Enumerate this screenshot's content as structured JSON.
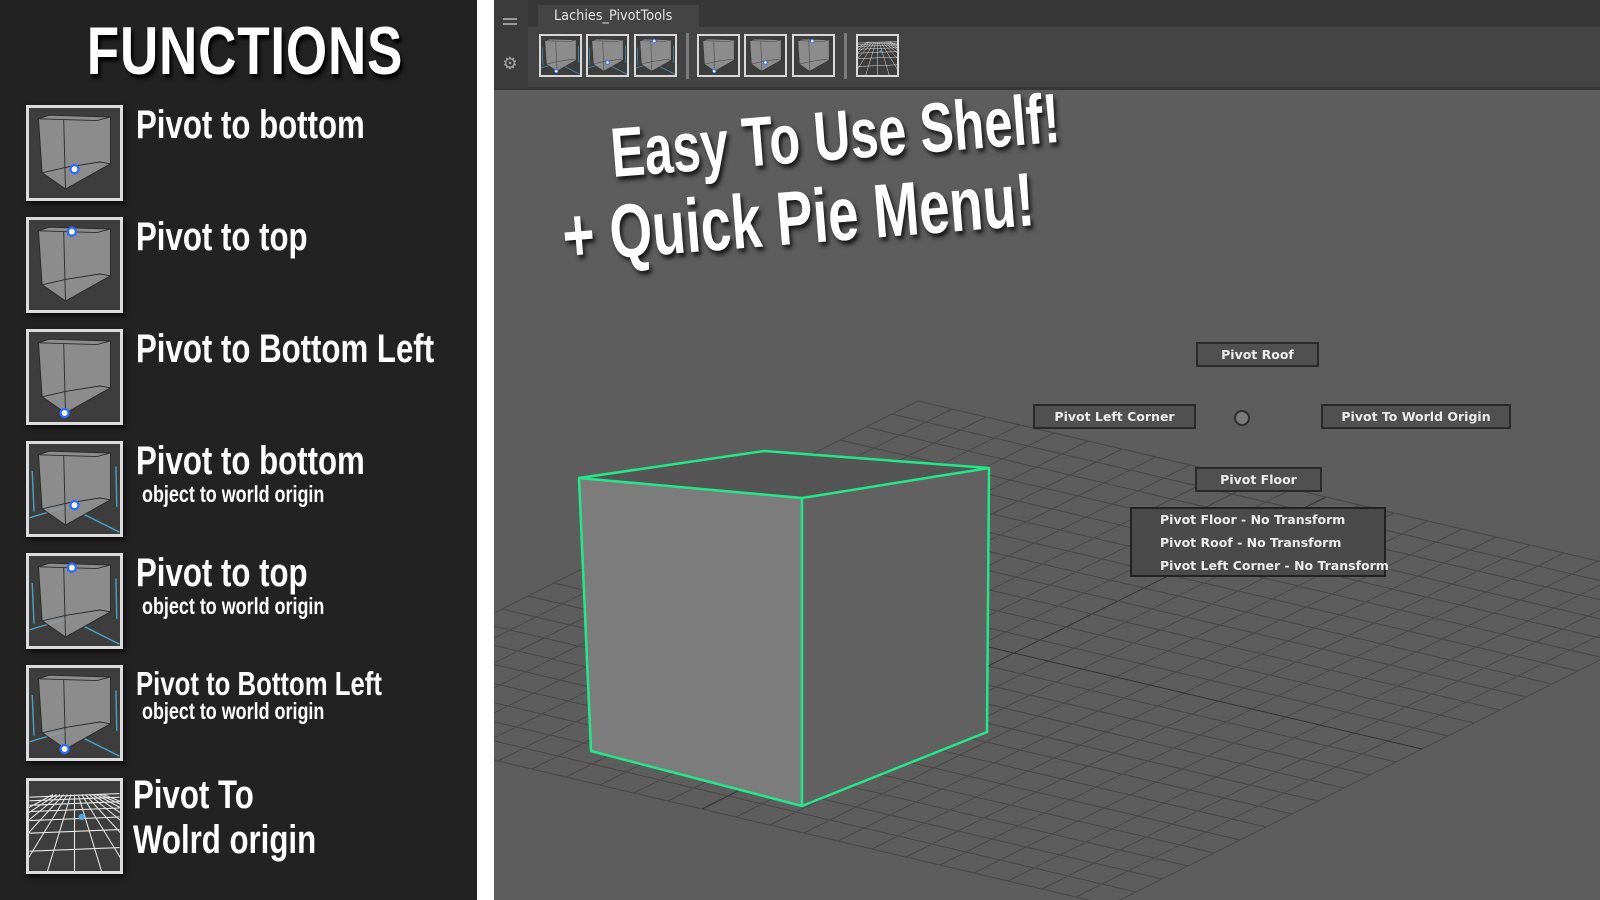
{
  "left_panel": {
    "title": "FUNCTIONS",
    "items": [
      {
        "label": "Pivot to bottom",
        "sub": "",
        "icon": "cube-pivot-bottom-icon"
      },
      {
        "label": "Pivot to top",
        "sub": "",
        "icon": "cube-pivot-top-icon"
      },
      {
        "label": "Pivot to Bottom Left",
        "sub": "",
        "icon": "cube-pivot-bottom-left-icon"
      },
      {
        "label": "Pivot to bottom",
        "sub": "object to world origin",
        "icon": "cube-grid-pivot-bottom-icon"
      },
      {
        "label": "Pivot to top",
        "sub": "object to world origin",
        "icon": "cube-grid-pivot-top-icon"
      },
      {
        "label": "Pivot to Bottom Left",
        "sub": "object to world origin",
        "icon": "cube-grid-pivot-bottom-left-icon"
      },
      {
        "label_line1": "Pivot To",
        "label_line2": "Wolrd origin",
        "icon": "world-grid-origin-icon"
      }
    ]
  },
  "maya": {
    "shelf": {
      "tab_label": "Lachies_PivotTools",
      "menu_icon": "menu-icon",
      "settings_icon": "gear-icon",
      "buttons": [
        {
          "name": "shelf-pivot-bottom-left",
          "icon": "cube-pivot-bottom-left-icon"
        },
        {
          "name": "shelf-pivot-bottom",
          "icon": "cube-pivot-bottom-icon"
        },
        {
          "name": "shelf-pivot-top",
          "icon": "cube-pivot-top-icon"
        },
        {
          "name": "shelf-pivot-bottom-left-world",
          "icon": "cube-pivot-bottom-left-icon"
        },
        {
          "name": "shelf-pivot-bottom-world",
          "icon": "cube-pivot-bottom-icon"
        },
        {
          "name": "shelf-pivot-top-world",
          "icon": "cube-pivot-top-icon"
        },
        {
          "name": "shelf-pivot-world-origin",
          "icon": "world-grid-origin-icon"
        }
      ]
    },
    "headline": {
      "line1": "Easy To Use Shelf!",
      "line2": "+ Quick Pie Menu!"
    },
    "pie_menu": {
      "north": "Pivot Roof",
      "west": "Pivot Left Corner",
      "east": "Pivot To World Origin",
      "south": "Pivot Floor",
      "list": [
        "Pivot Floor - No Transform",
        "Pivot Roof - No Transform",
        "Pivot Left Corner - No Transform"
      ]
    },
    "colors": {
      "selection_outline": "#22e88a",
      "pivot_dot": "#2a6bff",
      "grid_line": "#4a9fc0"
    }
  }
}
